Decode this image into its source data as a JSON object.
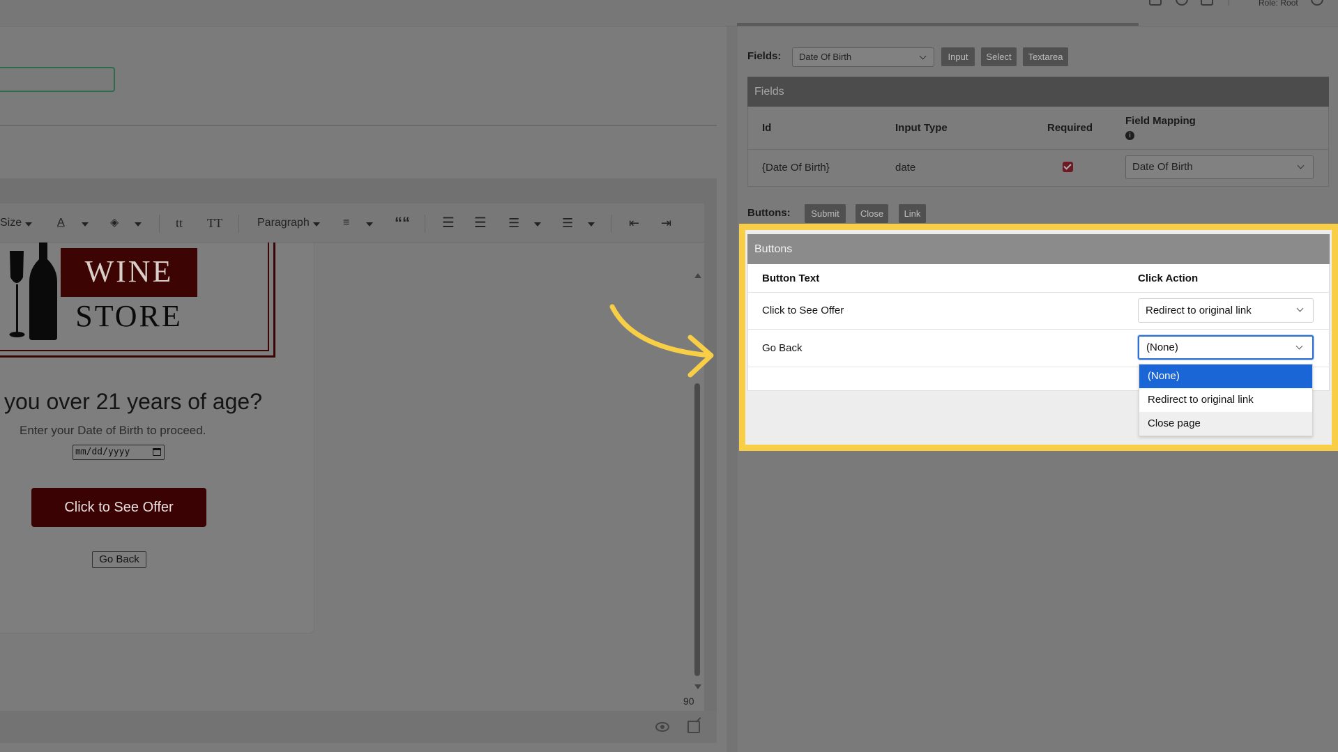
{
  "topbar": {
    "role": "Role: Root"
  },
  "editor": {
    "toolbar": {
      "size_label": "Size",
      "font_color_label": "A",
      "format_label": "Paragraph",
      "quote_label": "““",
      "lowercase_label": "tt",
      "titlecase_label": "TT"
    },
    "logo": {
      "line1": "WINE",
      "line2": "STORE"
    },
    "question": "you over 21 years of age?",
    "subtitle": "Enter your Date of Birth to proceed.",
    "date_placeholder": "mm/dd/yyyy",
    "offer_button": "Click to See Offer",
    "goback_button": "Go Back",
    "zoom": "90"
  },
  "panel": {
    "fields_label": "Fields:",
    "fields_select": "Date Of Birth",
    "field_types": [
      "Input",
      "Select",
      "Textarea"
    ],
    "fields_card": {
      "title": "Fields",
      "headers": {
        "id": "Id",
        "input_type": "Input Type",
        "required": "Required",
        "mapping": "Field Mapping"
      },
      "row": {
        "id": "{Date Of Birth}",
        "input_type": "date",
        "required": true,
        "mapping": "Date Of Birth"
      }
    },
    "buttons_label": "Buttons:",
    "button_types": [
      "Submit",
      "Close",
      "Link"
    ],
    "buttons_card": {
      "title": "Buttons",
      "headers": {
        "text": "Button Text",
        "action": "Click Action"
      },
      "rows": [
        {
          "text": "Click to See Offer",
          "action": "Redirect to original link"
        },
        {
          "text": "Go Back",
          "action": "(None)"
        }
      ],
      "dropdown_options": [
        "(None)",
        "Redirect to original link",
        "Close page"
      ]
    }
  },
  "colors": {
    "highlight": "#f7ce45",
    "brand_dark_red": "#3d0404",
    "select_blue": "#1a66d6"
  }
}
